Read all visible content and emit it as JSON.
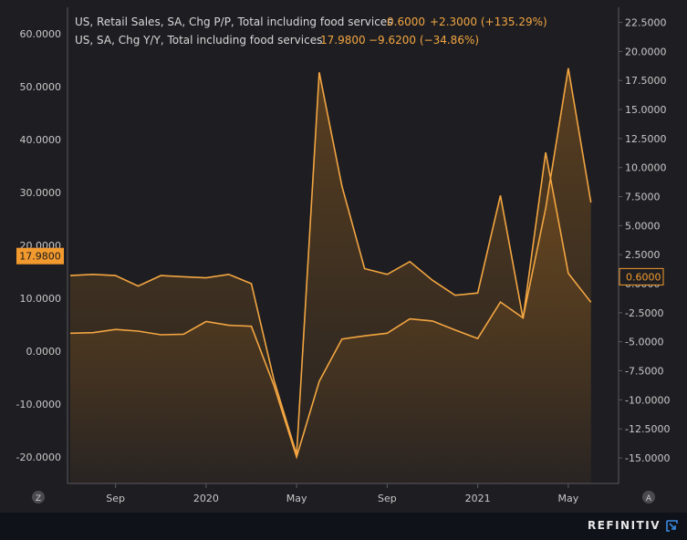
{
  "colors": {
    "background": "#1e1e22",
    "page": "#0f1218",
    "gridline": "#3a3a3f",
    "axis_text": "#c8c8c8",
    "series_primary": "#f2a541",
    "series_secondary": "#f2a541",
    "price_tag": "#f29a2e"
  },
  "legend": {
    "primary_name": "US, Retail Sales, SA, Chg P/P, Total including food services",
    "primary_last": "0.6000",
    "primary_change": "+2.3000 (+135.29%)",
    "secondary_name": "US, SA, Chg Y/Y, Total including food services",
    "secondary_last": "17.9800",
    "secondary_change": "−9.6200 (−34.86%)"
  },
  "corner_buttons": {
    "left": "Z",
    "right": "A"
  },
  "brand": "REFINITIV",
  "chart_data": {
    "type": "line",
    "x": [
      "2019-07",
      "2019-08",
      "2019-09",
      "2019-10",
      "2019-11",
      "2019-12",
      "2020-01",
      "2020-02",
      "2020-03",
      "2020-04",
      "2020-05",
      "2020-06",
      "2020-07",
      "2020-08",
      "2020-09",
      "2020-10",
      "2020-11",
      "2020-12",
      "2021-01",
      "2021-02",
      "2021-03",
      "2021-04",
      "2021-05",
      "2021-06"
    ],
    "x_tick_labels": [
      "Sep",
      "2020",
      "May",
      "Sep",
      "2021",
      "May"
    ],
    "x_tick_dates": [
      "2019-09",
      "2020-01",
      "2020-05",
      "2020-09",
      "2021-01",
      "2021-05"
    ],
    "series": [
      {
        "name": "US, SA, Chg Y/Y, Total including food services",
        "axis": "left",
        "values": [
          3.4,
          3.5,
          4.1,
          3.8,
          3.1,
          3.2,
          5.6,
          4.9,
          4.7,
          -6.5,
          -20.0,
          -5.7,
          2.3,
          2.9,
          3.4,
          6.1,
          5.7,
          4.0,
          2.4,
          9.3,
          6.3,
          27.0,
          53.5,
          28.1,
          17.98
        ]
      },
      {
        "name": "US, Retail Sales, SA, Chg P/P, Total including food services",
        "axis": "right",
        "values": [
          0.7,
          0.8,
          0.7,
          -0.2,
          0.7,
          0.6,
          0.5,
          0.8,
          0.0,
          -8.3,
          -14.7,
          18.2,
          8.4,
          1.3,
          0.8,
          1.9,
          0.3,
          -1.0,
          -0.8,
          7.6,
          -3.0,
          11.3,
          0.9,
          -1.6,
          0.6
        ]
      }
    ],
    "last_values": {
      "left": "17.9800",
      "right": "0.6000"
    },
    "left_axis": {
      "ticks": [
        "60.0000",
        "50.0000",
        "40.0000",
        "30.0000",
        "20.0000",
        "10.0000",
        "0.0000",
        "-10.0000",
        "-20.0000"
      ],
      "ylim": [
        -25,
        65
      ]
    },
    "right_axis": {
      "ticks": [
        "22.5000",
        "20.0000",
        "17.5000",
        "15.0000",
        "12.5000",
        "10.0000",
        "7.5000",
        "5.0000",
        "2.5000",
        "0.0000",
        "-2.5000",
        "-5.0000",
        "-7.5000",
        "-10.0000",
        "-12.5000",
        "-15.0000"
      ],
      "ylim": [
        -17.2,
        23.8
      ]
    },
    "grid": false
  }
}
